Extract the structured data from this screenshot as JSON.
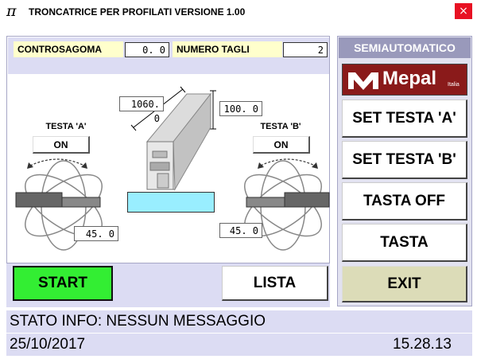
{
  "window": {
    "icon": "π",
    "title": "TRONCATRICE PER PROFILATI VERSIONE 1.00",
    "close_label": "×"
  },
  "top_fields": {
    "controsagoma_label": "CONTROSAGOMA",
    "controsagoma_value": "0. 0",
    "numero_tagli_label": "NUMERO TAGLI",
    "numero_tagli_value": "2"
  },
  "profile": {
    "length_value": "1060. 0",
    "height_value": "100. 0"
  },
  "head_a": {
    "label": "TESTA 'A'",
    "state": "ON",
    "angle": "45. 0"
  },
  "head_b": {
    "label": "TESTA 'B'",
    "state": "ON",
    "angle": "45. 0"
  },
  "buttons": {
    "start": "START",
    "lista": "LISTA",
    "exit": "EXIT"
  },
  "right_panel": {
    "mode": "SEMIAUTOMATICO",
    "logo_text": "Mepal",
    "logo_sub": "Italia",
    "set_testa_a": "SET TESTA 'A'",
    "set_testa_b": "SET TESTA 'B'",
    "tasta_off": "TASTA OFF",
    "tasta": "TASTA"
  },
  "status": {
    "info_label": "STATO INFO:",
    "info_message": "NESSUN MESSAGGIO",
    "date": "25/10/2017",
    "time": "15.28.13"
  },
  "colors": {
    "start_green": "#33ee33",
    "panel_lavender": "#dcdcf3",
    "cyan_field": "#99eeff",
    "close_red": "#e81123",
    "logo_red": "#8a1a1a"
  }
}
